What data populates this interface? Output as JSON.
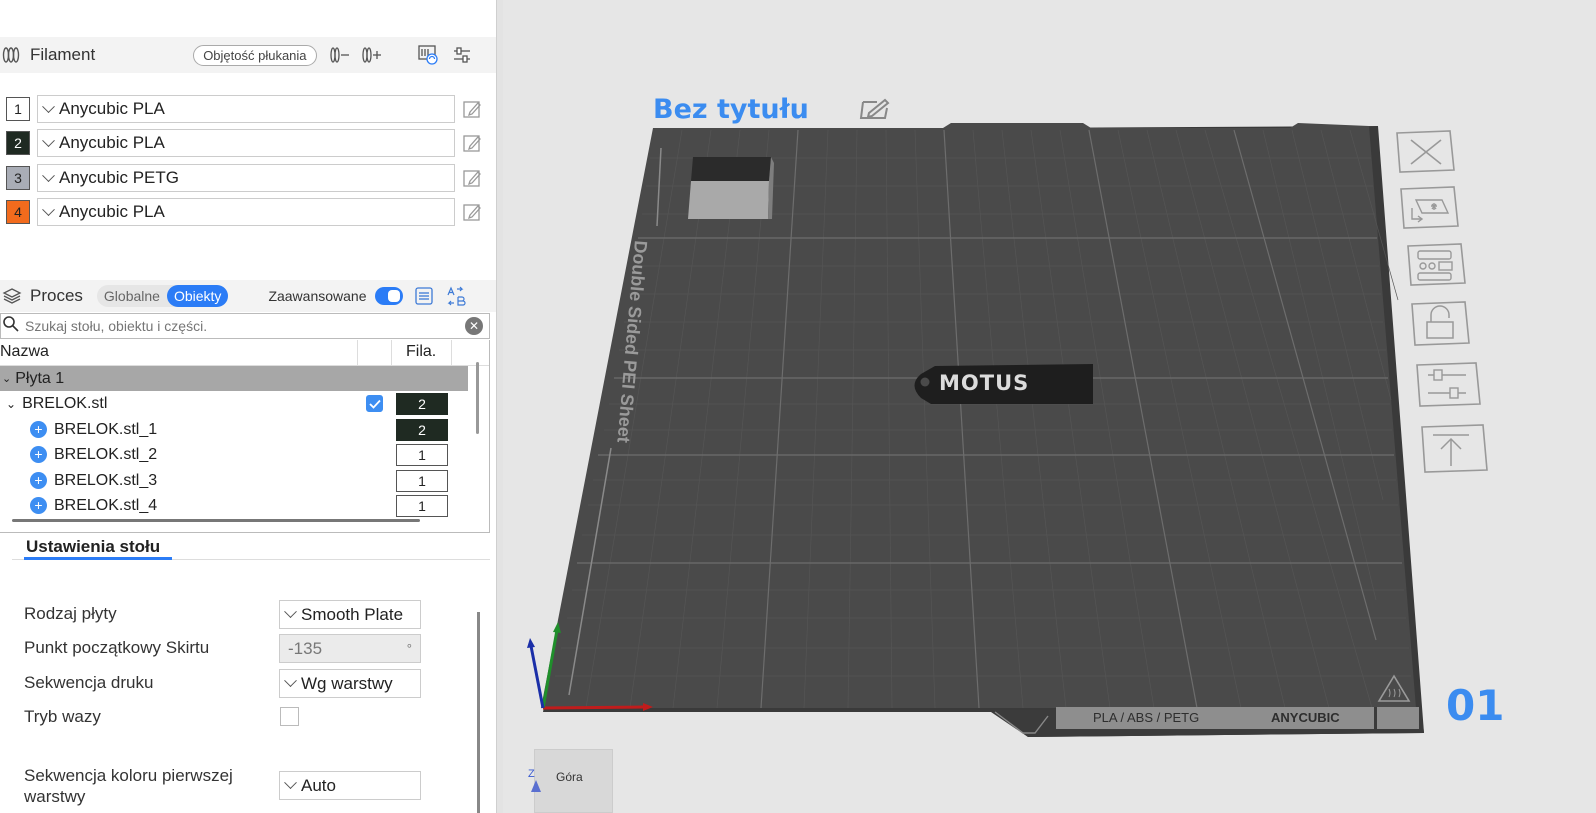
{
  "filament": {
    "title": "Filament",
    "flush_button": "Objętość płukania",
    "items": [
      {
        "num": "1",
        "color": "#ffffff",
        "text_color": "#222222",
        "name": "Anycubic PLA"
      },
      {
        "num": "2",
        "color": "#1f2a22",
        "text_color": "#ffffff",
        "name": "Anycubic PLA"
      },
      {
        "num": "3",
        "color": "#a9adb6",
        "text_color": "#222222",
        "name": "Anycubic PETG"
      },
      {
        "num": "4",
        "color": "#f26b1d",
        "text_color": "#222222",
        "name": "Anycubic PLA"
      }
    ]
  },
  "process": {
    "title": "Proces",
    "tab_global": "Globalne",
    "tab_objects": "Obiekty",
    "advanced_label": "Zaawansowane",
    "search_placeholder": "Szukaj stołu, obiektu i części."
  },
  "tree": {
    "col_name": "Nazwa",
    "col_fila": "Fila.",
    "plate_name": "Płyta 1",
    "object": {
      "name": "BRELOK.stl",
      "fila": "2"
    },
    "parts": [
      {
        "name": "BRELOK.stl_1",
        "fila": "2"
      },
      {
        "name": "BRELOK.stl_2",
        "fila": "1"
      },
      {
        "name": "BRELOK.stl_3",
        "fila": "1"
      },
      {
        "name": "BRELOK.stl_4",
        "fila": "1"
      }
    ]
  },
  "bed_settings": {
    "tab_label": "Ustawienia stołu",
    "plate_type_label": "Rodzaj płyty",
    "plate_type_value": "Smooth Plate",
    "skirt_start_label": "Punkt początkowy Skirtu",
    "skirt_start_value": "-135",
    "skirt_start_unit": "°",
    "print_sequence_label": "Sekwencja druku",
    "print_sequence_value": "Wg warstwy",
    "vase_label": "Tryb wazy",
    "first_layer_color_label": "Sekwencja koloru pierwszej warstwy",
    "first_layer_color_value": "Auto"
  },
  "viewport": {
    "plate_title": "Bez tytułu",
    "plate_number": "01",
    "bed_side_text": "Double Sided PEI Sheet",
    "bed_materials": "PLA / ABS / PETG",
    "bed_brand": "ANYCUBIC",
    "model_label": "MOTUS",
    "view_cube_label": "Góra",
    "axis_z_label": "Z"
  },
  "colors": {
    "accent": "#2b7cf6",
    "plate_title": "#3b8cf0",
    "bed_surface": "#4a4a4a"
  }
}
